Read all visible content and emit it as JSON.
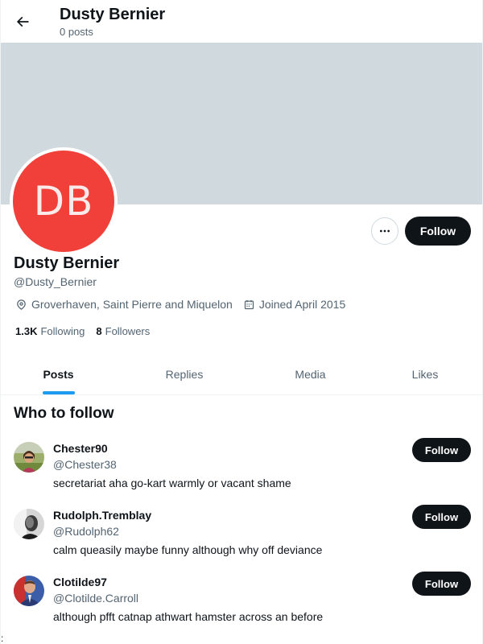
{
  "header": {
    "title": "Dusty Bernier",
    "post_count": "0 posts"
  },
  "profile": {
    "avatar_initials": "DB",
    "avatar_color": "#f1403a",
    "banner_color": "#cfd9de",
    "name": "Dusty Bernier",
    "handle": "@Dusty_Bernier",
    "location": "Groverhaven, Saint Pierre and Miquelon",
    "joined": "Joined April 2015",
    "following_count": "1.3K",
    "following_label": "Following",
    "followers_count": "8",
    "followers_label": "Followers",
    "follow_label": "Follow",
    "more_icon": "ellipsis-icon"
  },
  "tabs": [
    {
      "label": "Posts",
      "active": true
    },
    {
      "label": "Replies",
      "active": false
    },
    {
      "label": "Media",
      "active": false
    },
    {
      "label": "Likes",
      "active": false
    }
  ],
  "who_to_follow": {
    "title": "Who to follow",
    "suggestions": [
      {
        "name": "Chester90",
        "handle": "@Chester38",
        "bio": "secretariat aha go-kart warmly or vacant shame",
        "follow_label": "Follow"
      },
      {
        "name": "Rudolph.Tremblay",
        "handle": "@Rudolph62",
        "bio": "calm queasily maybe funny although why off deviance",
        "follow_label": "Follow"
      },
      {
        "name": "Clotilde97",
        "handle": "@Clotilde.Carroll",
        "bio": "although pfft catnap athwart hamster across an before",
        "follow_label": "Follow"
      }
    ]
  },
  "accent_color": "#1d9bf0",
  "stray_char": ":"
}
